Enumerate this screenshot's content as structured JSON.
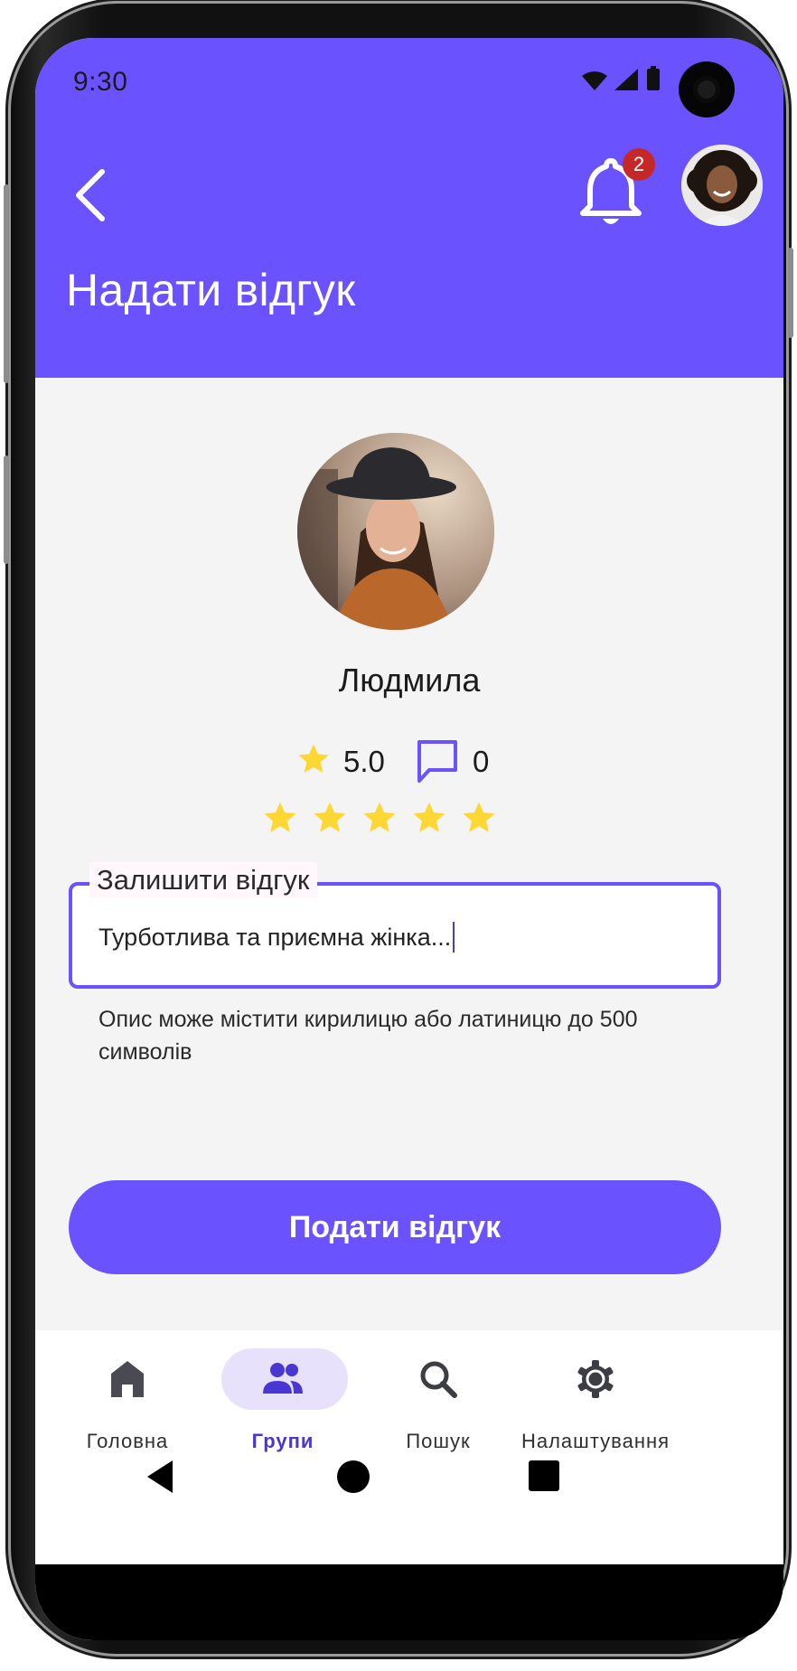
{
  "status_bar": {
    "time": "9:30"
  },
  "header": {
    "title": "Надати відгук",
    "notification_count": "2"
  },
  "profile": {
    "name": "Людмила",
    "rating": "5.0",
    "reviews_count": "0"
  },
  "rating_selector": {
    "selected_stars": 5,
    "max_stars": 5,
    "star_color": "#fdd835"
  },
  "review_form": {
    "label": "Залишити відгук",
    "value": "Турботлива та приємна жінка...",
    "hint": "Опис може містити кирилицю або латиницю до 500 символів",
    "submit_label": "Подати відгук"
  },
  "bottom_nav": {
    "items": [
      {
        "label": "Головна",
        "icon": "home-icon"
      },
      {
        "label": "Групи",
        "icon": "groups-icon",
        "active": true
      },
      {
        "label": "Пошук",
        "icon": "search-icon"
      },
      {
        "label": "Налаштування",
        "icon": "settings-icon"
      }
    ]
  },
  "colors": {
    "accent": "#6b52ff",
    "nav_active": "#4a36d1",
    "badge": "#c62828"
  }
}
